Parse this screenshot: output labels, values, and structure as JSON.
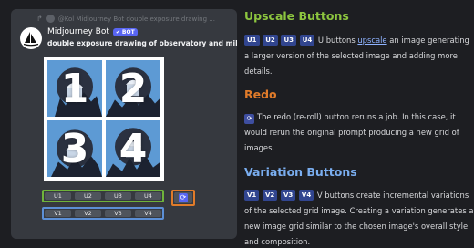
{
  "message": {
    "reply_text": "@Kol  Midjourney Bot double exposure drawing ...",
    "author": "Midjourney Bot",
    "badge": "BOT",
    "prompt": "double exposure drawing of observatory and milkyway",
    "tiles": [
      "1",
      "2",
      "3",
      "4"
    ],
    "upscale_buttons": [
      "U1",
      "U2",
      "U3",
      "U4"
    ],
    "variation_buttons": [
      "V1",
      "V2",
      "V3",
      "V4"
    ],
    "colors": {
      "upscale_outline": "#6fb33b",
      "variation_outline": "#5c8fd6",
      "redo_outline": "#e07b2a"
    }
  },
  "doc": {
    "upscale": {
      "heading": "Upscale Buttons",
      "tags": [
        "U1",
        "U2",
        "U3",
        "U4"
      ],
      "text_before_link": " U buttons ",
      "link": "upscale",
      "text_after_link": " an image generating a larger version of the selected image and adding more details."
    },
    "redo": {
      "heading": "Redo",
      "text": "The redo (re-roll) button reruns a job. In this case, it would rerun the original prompt producing a new grid of images."
    },
    "variation": {
      "heading": "Variation Buttons",
      "tags": [
        "V1",
        "V2",
        "V3",
        "V4"
      ],
      "text": " V buttons create incremental variations of the selected grid image. Creating a variation generates a new image grid similar to the chosen image's overall style and composition."
    }
  }
}
